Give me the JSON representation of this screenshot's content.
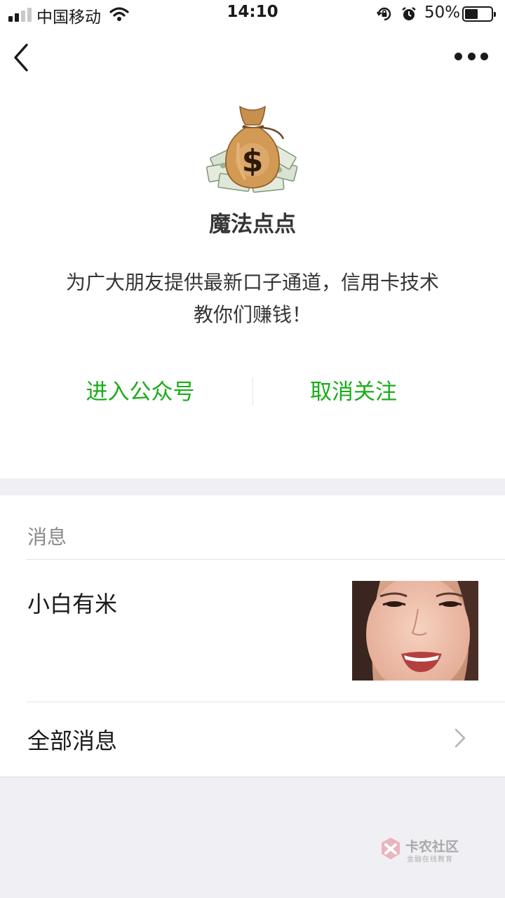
{
  "status_bar": {
    "carrier": "中国移动",
    "time": "14:10",
    "battery_percent": "50%",
    "battery_level": 0.5,
    "signal_bars_filled": 2,
    "signal_bars_total": 4
  },
  "nav": {
    "back_icon": "chevron-left-icon",
    "more_icon": "more-dots-icon"
  },
  "profile": {
    "name": "魔法点点",
    "description": "为广大朋友提供最新口子通道，信用卡技术 教你们赚钱！",
    "avatar_icon": "money-bag-icon"
  },
  "actions": {
    "enter_label": "进入公众号",
    "unfollow_label": "取消关注"
  },
  "messages": {
    "section_title": "消息",
    "items": [
      {
        "title": "小白有米"
      }
    ],
    "all_messages_label": "全部消息"
  },
  "watermark": {
    "name": "卡农社区",
    "subtitle": "金融在线教育"
  },
  "colors": {
    "accent_green": "#1aad19",
    "background_gray": "#efeff4",
    "text_primary": "#1a1a1a",
    "text_secondary": "#888888"
  }
}
